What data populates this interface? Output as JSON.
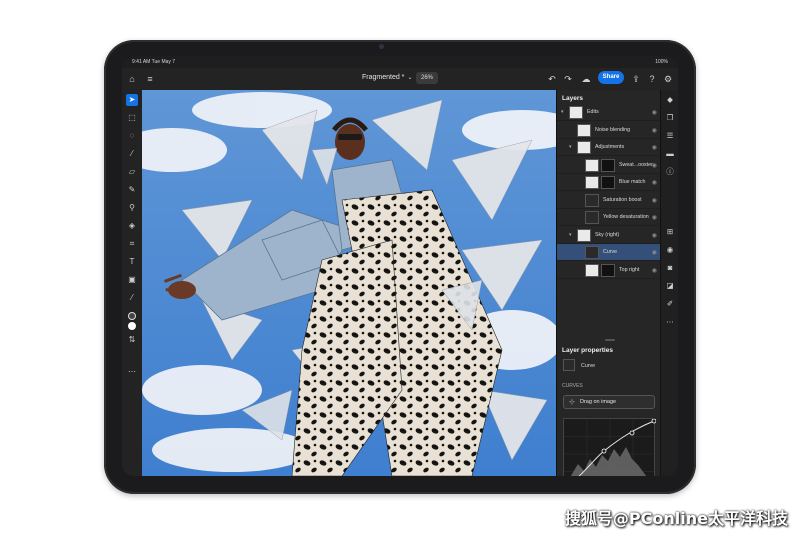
{
  "status_bar": {
    "time": "9:41 AM  Tue May 7",
    "battery": "100%"
  },
  "top_bar": {
    "document_title": "Fragmented *",
    "zoom": "26%",
    "share_label": "Share"
  },
  "tools": [
    {
      "name": "select-tool",
      "glyph": "➤"
    },
    {
      "name": "artboard-tool",
      "glyph": "⬚"
    },
    {
      "name": "lasso-tool",
      "glyph": "◌"
    },
    {
      "name": "brush-tool",
      "glyph": "⁄"
    },
    {
      "name": "eraser-tool",
      "glyph": "▱"
    },
    {
      "name": "healing-tool",
      "glyph": "✎"
    },
    {
      "name": "clone-tool",
      "glyph": "⚲"
    },
    {
      "name": "fill-tool",
      "glyph": "◈"
    },
    {
      "name": "crop-tool",
      "glyph": "⌗"
    },
    {
      "name": "type-tool",
      "glyph": "T"
    },
    {
      "name": "place-image-tool",
      "glyph": "▣"
    },
    {
      "name": "eyedropper-tool",
      "glyph": "⁄"
    }
  ],
  "layers_panel": {
    "title": "Layers",
    "layers": [
      {
        "name": "Edits",
        "indent": 0,
        "kind": "group"
      },
      {
        "name": "Noise blending",
        "indent": 1,
        "kind": "layer"
      },
      {
        "name": "Adjustments",
        "indent": 1,
        "kind": "group"
      },
      {
        "name": "Sweat...ooster",
        "indent": 2,
        "kind": "masked"
      },
      {
        "name": "Blue match",
        "indent": 2,
        "kind": "masked"
      },
      {
        "name": "Saturation boost",
        "indent": 2,
        "kind": "adjust"
      },
      {
        "name": "Yellow desaturation",
        "indent": 2,
        "kind": "adjust"
      },
      {
        "name": "Sky (right)",
        "indent": 1,
        "kind": "group"
      },
      {
        "name": "Curve",
        "indent": 2,
        "kind": "curve",
        "selected": true
      },
      {
        "name": "Top right",
        "indent": 2,
        "kind": "masked"
      }
    ]
  },
  "layer_properties": {
    "title": "Layer properties",
    "layer_name": "Curve",
    "section": "CURVES",
    "drag_label": "Drag on image"
  },
  "colors": {
    "accent": "#1473e6",
    "panel": "#262626",
    "channel_red": "#d9342b",
    "channel_green": "#2fae4a",
    "channel_blue": "#3c76e0"
  },
  "watermark": "搜狐号@PConline太平洋科技"
}
